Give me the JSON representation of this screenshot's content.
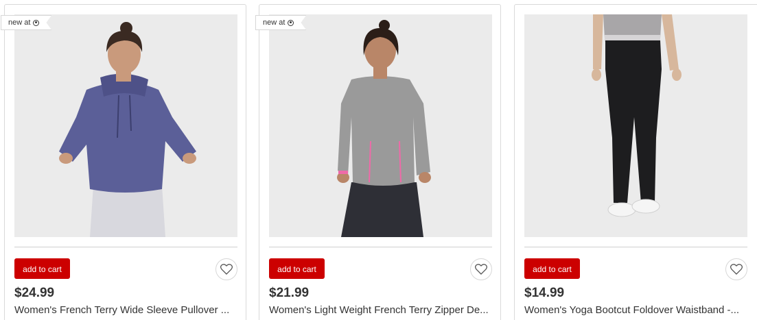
{
  "products": [
    {
      "badge": "new at",
      "add_to_cart": "add to cart",
      "price": "$24.99",
      "title": "Women's French Terry Wide Sleeve Pullover ..."
    },
    {
      "badge": "new at",
      "add_to_cart": "add to cart",
      "price": "$21.99",
      "title": "Women's Light Weight French Terry Zipper De..."
    },
    {
      "add_to_cart": "add to cart",
      "price": "$14.99",
      "title": "Women's Yoga Bootcut Foldover Waistband -..."
    }
  ],
  "colors": {
    "cart_button": "#cc0000",
    "image_bg": "#ebebeb"
  },
  "icons": {
    "badge_logo": "bullseye-icon",
    "favorite": "heart-icon"
  }
}
